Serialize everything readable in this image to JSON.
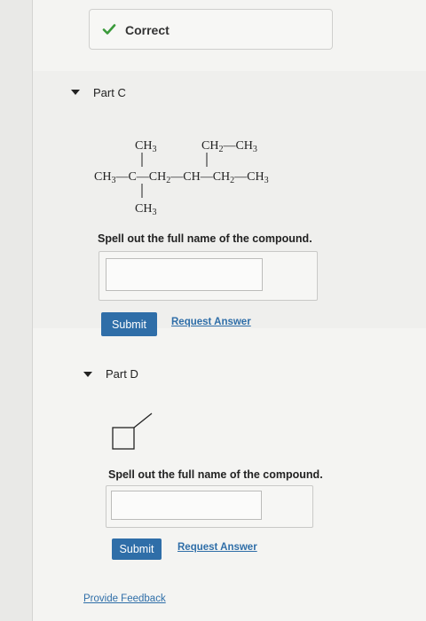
{
  "feedback": {
    "status_label": "Correct",
    "status_icon": "check-icon"
  },
  "part_c": {
    "title": "Part C",
    "structure": {
      "top_ch3": "CH3",
      "top_ethyl": "CH2—CH3",
      "main_chain": "CH3—C—CH2—CH—CH2—CH3",
      "bottom_ch3": "CH3"
    },
    "prompt": "Spell out the full name of the compound.",
    "answer_value": "",
    "submit_label": "Submit",
    "request_answer_label": "Request Answer"
  },
  "part_d": {
    "title": "Part D",
    "prompt": "Spell out the full name of the compound.",
    "answer_value": "",
    "submit_label": "Submit",
    "request_answer_label": "Request Answer"
  },
  "footer": {
    "provide_feedback_label": "Provide Feedback"
  },
  "colors": {
    "accent": "#2f6ea8",
    "check": "#3a9a3a",
    "background": "#f4f4f2"
  }
}
